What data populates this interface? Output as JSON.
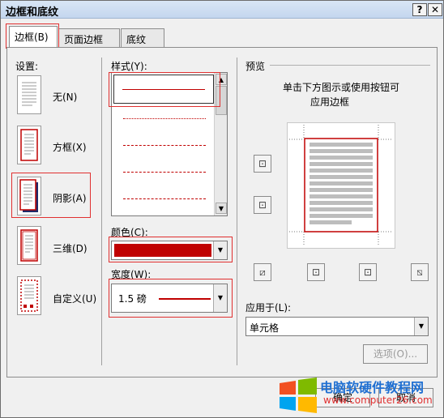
{
  "window": {
    "title": "边框和底纹",
    "help_btn": "?",
    "close_btn": "✕"
  },
  "tabs": [
    {
      "label": "边框(B)"
    },
    {
      "label": "页面边框(P)"
    },
    {
      "label": "底纹(S)"
    }
  ],
  "settings": {
    "label": "设置:",
    "items": [
      {
        "label": "无(N)"
      },
      {
        "label": "方框(X)"
      },
      {
        "label": "阴影(A)"
      },
      {
        "label": "三维(D)"
      },
      {
        "label": "自定义(U)"
      }
    ]
  },
  "style": {
    "label": "样式(Y):"
  },
  "color": {
    "label": "颜色(C):",
    "value_color": "#c00000"
  },
  "width": {
    "label": "宽度(W):",
    "value": "1.5 磅"
  },
  "preview": {
    "label": "预览",
    "hint": "单击下方图示或使用按钮可",
    "hint2": "应用边框"
  },
  "apply_to": {
    "label": "应用于(L):",
    "value": "单元格"
  },
  "buttons": {
    "options": "选项(O)...",
    "ok": "确定",
    "cancel": "取消"
  },
  "watermark": {
    "brand": "电脑软硬件教程网",
    "url": "www.computer26.com"
  },
  "accent": "#c00000"
}
